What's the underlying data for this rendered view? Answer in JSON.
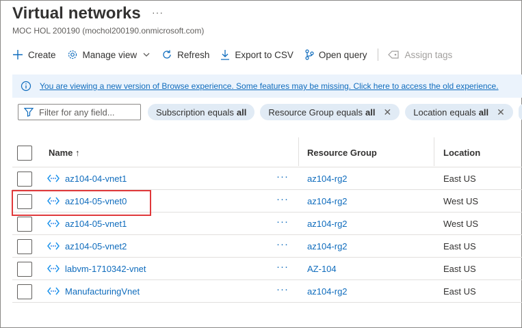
{
  "page": {
    "title": "Virtual networks",
    "more": "···",
    "subtitle": "MOC HOL 200190 (mochol200190.onmicrosoft.com)"
  },
  "toolbar": {
    "create": "Create",
    "manage_view": "Manage view",
    "refresh": "Refresh",
    "export_csv": "Export to CSV",
    "open_query": "Open query",
    "assign_tags": "Assign tags"
  },
  "banner": {
    "text": "You are viewing a new version of Browse experience. Some features may be missing. Click here to access the old experience."
  },
  "filters": {
    "placeholder": "Filter for any field...",
    "pills": [
      {
        "field": "Subscription",
        "op": "equals",
        "value": "all"
      },
      {
        "field": "Resource Group",
        "op": "equals",
        "value": "all",
        "close": "✕"
      },
      {
        "field": "Location",
        "op": "equals",
        "value": "all",
        "close": "✕"
      }
    ]
  },
  "table": {
    "headers": {
      "name": "Name ↑",
      "resource_group": "Resource Group",
      "location": "Location"
    },
    "row_menu": "···",
    "rows": [
      {
        "name": "az104-04-vnet1",
        "resource_group": "az104-rg2",
        "location": "East US"
      },
      {
        "name": "az104-05-vnet0",
        "resource_group": "az104-rg2",
        "location": "West US"
      },
      {
        "name": "az104-05-vnet1",
        "resource_group": "az104-rg2",
        "location": "West US"
      },
      {
        "name": "az104-05-vnet2",
        "resource_group": "az104-rg2",
        "location": "East US"
      },
      {
        "name": "labvm-1710342-vnet",
        "resource_group": "AZ-104",
        "location": "East US"
      },
      {
        "name": "ManufacturingVnet",
        "resource_group": "az104-rg2",
        "location": "East US"
      }
    ]
  },
  "colors": {
    "link": "#0f6cbd",
    "banner_bg": "#ebf3fc",
    "pill_bg": "#e1ebf5",
    "highlight": "#e0383a"
  }
}
